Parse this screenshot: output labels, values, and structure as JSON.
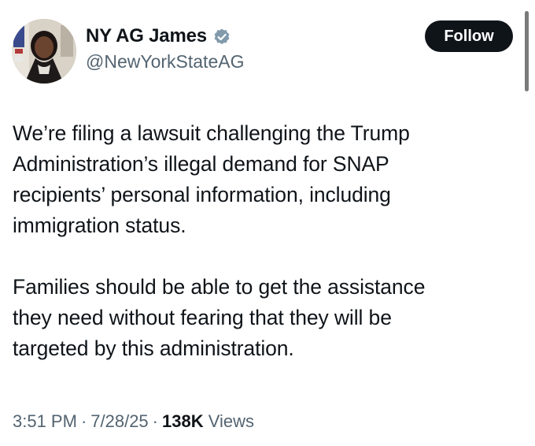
{
  "author": {
    "display_name": "NY AG James",
    "handle": "@NewYorkStateAG",
    "verified": true,
    "avatar_icon": "avatar-photo"
  },
  "follow_button": {
    "label": "Follow"
  },
  "tweet": {
    "paragraph_1": "We’re filing a lawsuit challenging the Trump\nAdministration’s illegal demand for SNAP\nrecipients’ personal information, including\nimmigration status.",
    "paragraph_2": "Families should be able to get the assistance\nthey need without fearing that they will be\ntargeted by this administration."
  },
  "meta": {
    "time": "3:51 PM",
    "separator": "·",
    "date": "7/28/25",
    "views_count": "138K",
    "views_label": "Views"
  },
  "colors": {
    "text_primary": "#0f1419",
    "text_secondary": "#536471",
    "verified_badge": "#829aab",
    "follow_bg": "#0f1419"
  }
}
